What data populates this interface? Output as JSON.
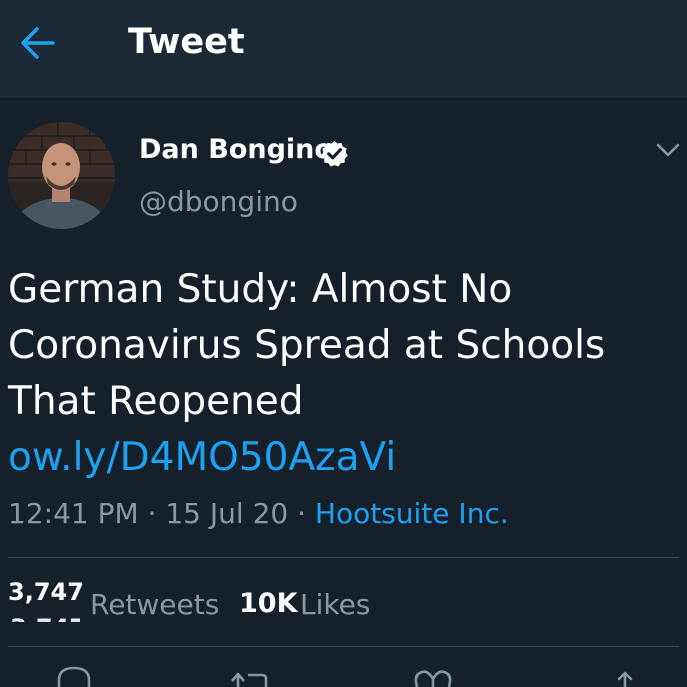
{
  "header": {
    "title": "Tweet",
    "back_icon": "back-arrow-icon"
  },
  "author": {
    "name": "Dan Bongino",
    "handle": "@dbongino",
    "verified": true
  },
  "tweet": {
    "text_lines": [
      "German Study: Almost No",
      "Coronavirus Spread at Schools",
      "That Reopened"
    ],
    "link": "ow.ly/D4MO50AzaVi",
    "time": "12:41 PM",
    "separator": "·",
    "date": "15 Jul 20",
    "source": "Hootsuite Inc."
  },
  "stats": {
    "retweets_count": "3,747",
    "retweets_label": "Retweets",
    "likes_count": "10K",
    "likes_label": "Likes"
  },
  "actions": [
    "reply-icon",
    "retweet-icon",
    "like-icon",
    "share-icon"
  ],
  "colors": {
    "background": "#15202b",
    "header": "#1b2836",
    "accent": "#1da1f2",
    "muted": "#8899a6",
    "divider": "#38444d"
  }
}
